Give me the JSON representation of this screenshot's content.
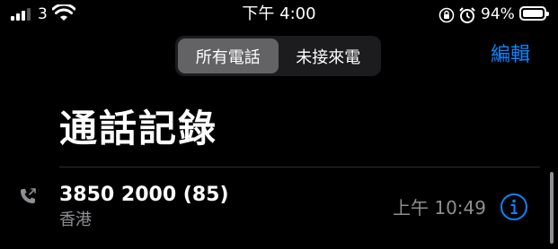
{
  "status_bar": {
    "carrier": "3",
    "time": "下午 4:00",
    "battery": "94%"
  },
  "segments": [
    {
      "label": "所有電話",
      "selected": true
    },
    {
      "label": "未接來電",
      "selected": false
    }
  ],
  "header": {
    "edit_label": "編輯",
    "title": "通話記錄"
  },
  "calls": [
    {
      "name": "3850 2000 (85)",
      "location": "香港",
      "time": "上午 10:49",
      "icon": "outgoing-call-icon"
    }
  ],
  "colors": {
    "accent": "#0a84ff",
    "secondary_text": "#8e8e93",
    "segment_selected": "#636366",
    "segment_background": "#1c1c1e"
  }
}
